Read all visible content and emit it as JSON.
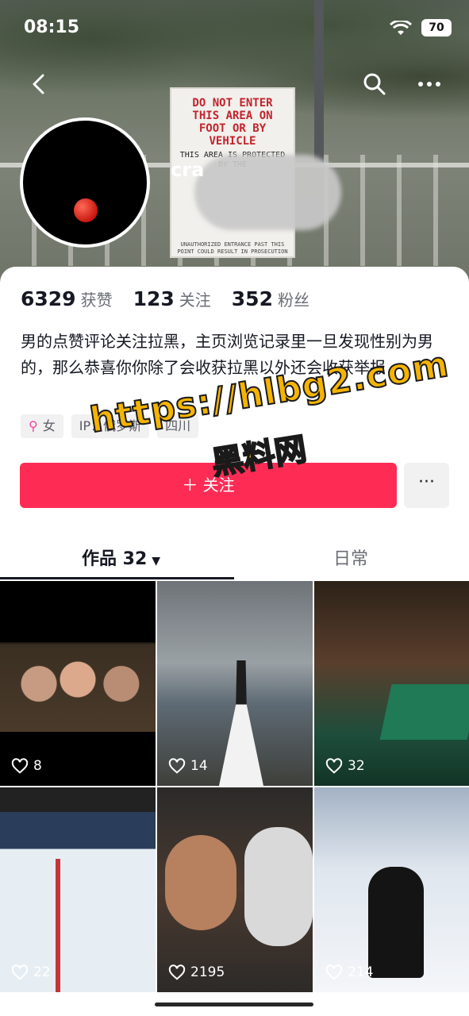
{
  "status_bar": {
    "time": "08:15",
    "battery": "70"
  },
  "profile": {
    "username": "cra",
    "likes": "6329",
    "likes_label": "获赞",
    "following": "123",
    "following_label": "关注",
    "followers": "352",
    "followers_label": "粉丝",
    "bio": "男的点赞评论关注拉黑，主页浏览记录里一旦发现性别为男的，那么恭喜你你除了会收获拉黑以外还会收获举报",
    "tags": {
      "gender": "女",
      "ip": "IP：俄罗斯",
      "region": "四川"
    },
    "follow_label": "＋ 关注"
  },
  "cover_sign": {
    "line1": "DO NOT ENTER THIS AREA ON FOOT OR BY VEHICLE",
    "line2": "THIS AREA IS PROTECTED BY THE",
    "line3": "UNAUTHORIZED ENTRANCE PAST THIS POINT COULD RESULT IN PROSECUTION"
  },
  "tabs": [
    {
      "label": "作品 32",
      "active": true
    },
    {
      "label": "日常",
      "active": false
    }
  ],
  "posts": [
    {
      "likes": "8"
    },
    {
      "likes": "14"
    },
    {
      "likes": "32"
    },
    {
      "likes": "22"
    },
    {
      "likes": "2195"
    },
    {
      "likes": "214"
    }
  ],
  "watermark": {
    "url": "https://hlbg2.com",
    "name": "黑料网"
  },
  "colors": {
    "accent": "#fe2c55",
    "watermark": "#f5b400"
  }
}
